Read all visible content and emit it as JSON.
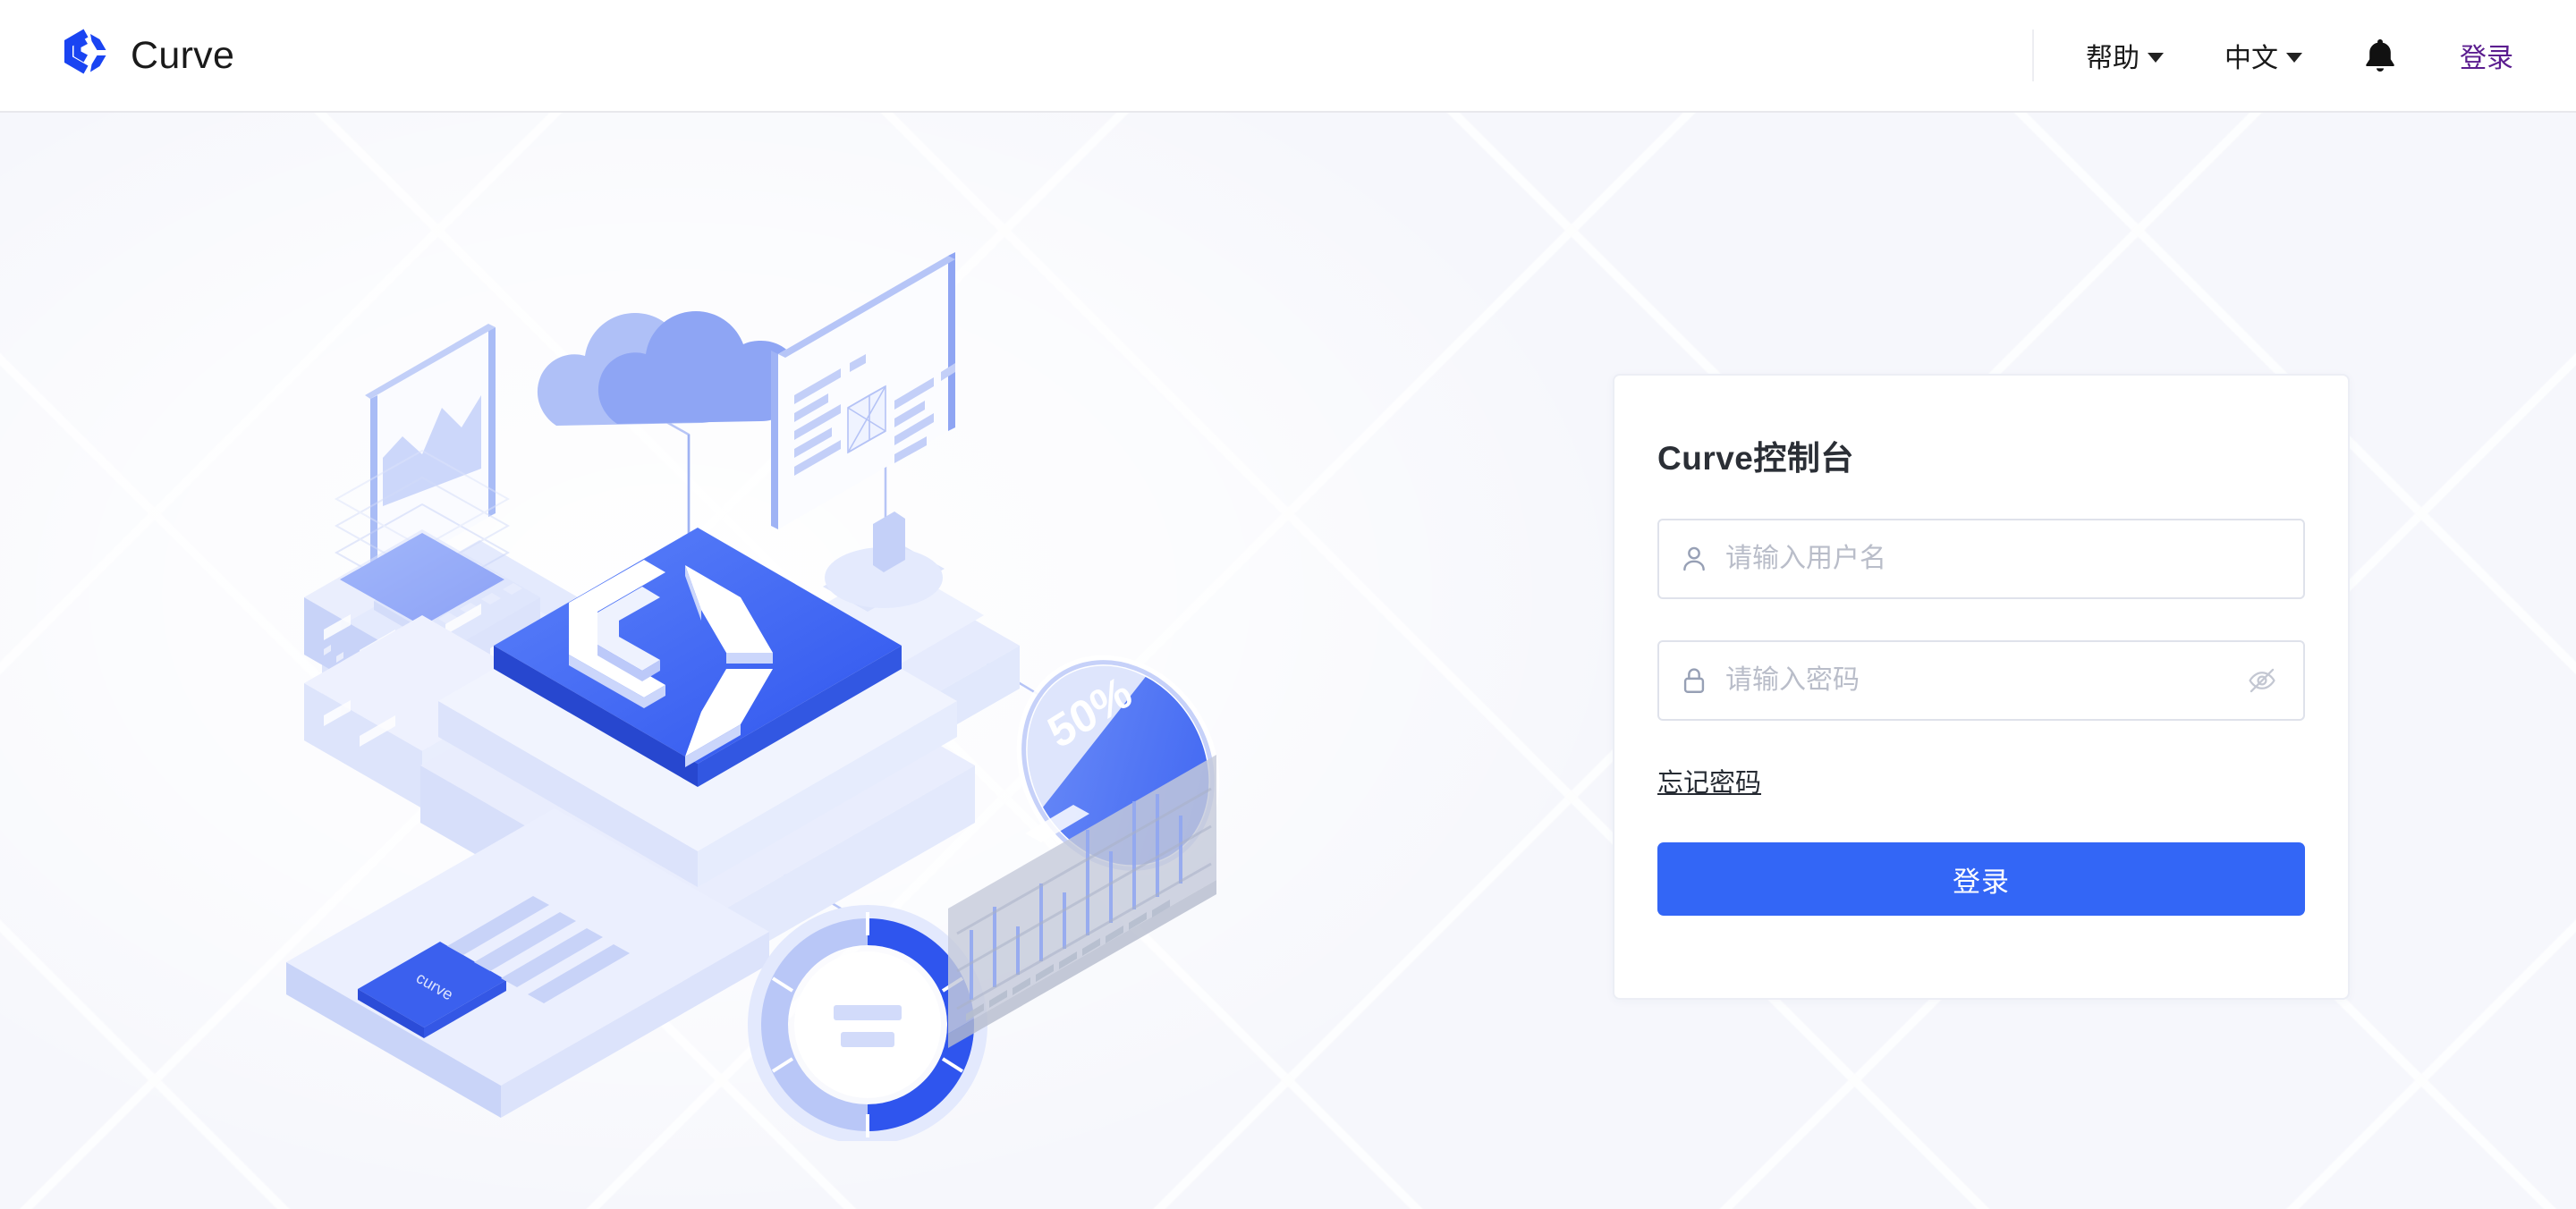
{
  "brand": {
    "name": "Curve",
    "logo_icon": "curve-logo-icon",
    "logo_color": "#1A44F2"
  },
  "header": {
    "help": {
      "label": "帮助",
      "caret_icon": "chevron-down-icon"
    },
    "language": {
      "label": "中文",
      "caret_icon": "chevron-down-icon"
    },
    "notifications": {
      "icon": "bell-icon"
    },
    "login_link": {
      "label": "登录",
      "color": "#5B1D8F"
    }
  },
  "login_card": {
    "title": "Curve控制台",
    "username": {
      "placeholder": "请输入用户名",
      "value": "",
      "icon": "user-icon"
    },
    "password": {
      "placeholder": "请输入密码",
      "value": "",
      "icon": "lock-icon",
      "toggle_icon": "eye-off-icon"
    },
    "forgot_password": "忘记密码",
    "submit": {
      "label": "登录",
      "color": "#3366F6"
    }
  },
  "illustration": {
    "name": "curve-isometric-illustration",
    "gauge_label": "50%",
    "document_label": "curve",
    "accent_color": "#3A63F3",
    "light_color": "#C6D0FA",
    "pale_color": "#E8ECFD"
  },
  "colors": {
    "page_background": "#F6F7FC",
    "header_background": "#FFFFFF",
    "card_background": "#FFFFFF",
    "card_border": "#ECEEF5",
    "field_border": "#DFE2EB",
    "placeholder": "#B9BDC9",
    "primary": "#3366F6"
  }
}
